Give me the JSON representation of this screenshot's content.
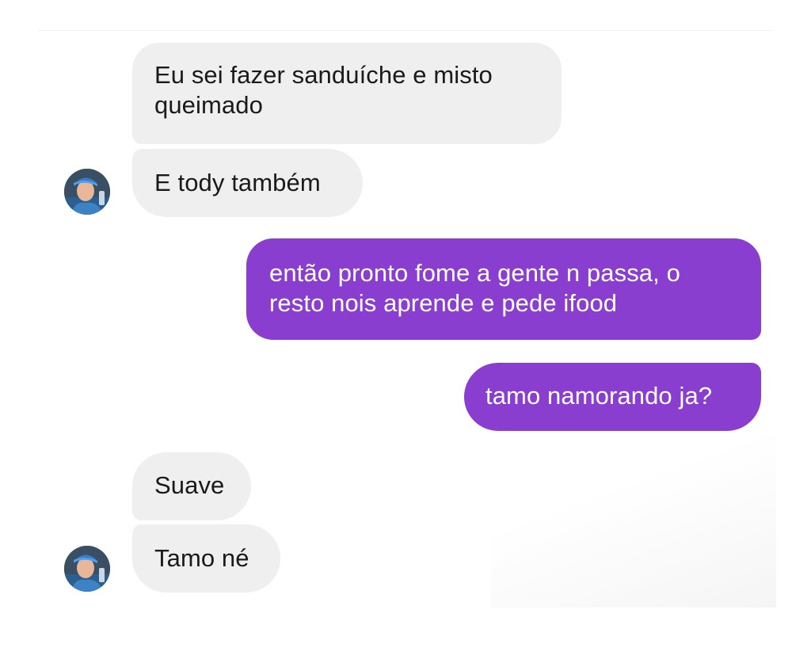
{
  "conversation": {
    "messages": [
      {
        "sender": "them",
        "text_lines": [
          "Eu sei fazer sanduíche e misto",
          "queimado"
        ]
      },
      {
        "sender": "them",
        "text_lines": [
          "E tody também"
        ]
      },
      {
        "sender": "me",
        "text_lines": [
          "então pronto fome a gente n passa, o",
          "resto nois aprende e pede ifood"
        ]
      },
      {
        "sender": "me",
        "text_lines": [
          "tamo namorando ja?"
        ]
      },
      {
        "sender": "them",
        "text_lines": [
          "Suave"
        ]
      },
      {
        "sender": "them",
        "text_lines": [
          "Tamo né"
        ]
      }
    ]
  },
  "colors": {
    "incoming_bubble": "#efefef",
    "outgoing_bubble": "#8a3ecf",
    "incoming_text": "#1a1a1a",
    "outgoing_text": "#ffffff"
  },
  "icons": {
    "contact_avatar": "contact-avatar"
  }
}
